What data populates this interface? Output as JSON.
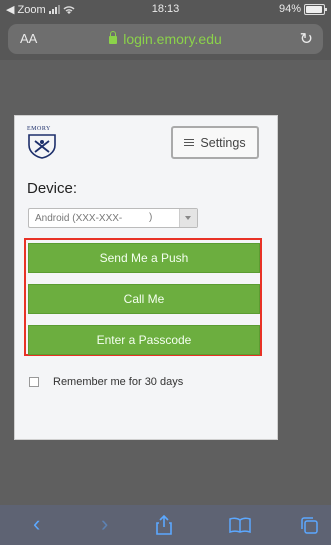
{
  "status_bar": {
    "back_label": "◀ Zoom",
    "time": "18:13",
    "battery": "94%",
    "battery_level": 0.94
  },
  "browser": {
    "aa_label": "AA",
    "url": "login.emory.edu"
  },
  "card": {
    "logo_text": "EMORY",
    "settings_label": "Settings",
    "device_label": "Device:",
    "device_value": "Android (XXX-XXX-",
    "buttons": [
      {
        "label": "Send Me a Push"
      },
      {
        "label": "Call Me"
      },
      {
        "label": "Enter a Passcode"
      }
    ],
    "remember_label": "Remember me for 30 days"
  },
  "colors": {
    "green_button": "#6cae3f",
    "highlight_border": "#e83226",
    "toolbar_icon": "#5ca8ff"
  }
}
